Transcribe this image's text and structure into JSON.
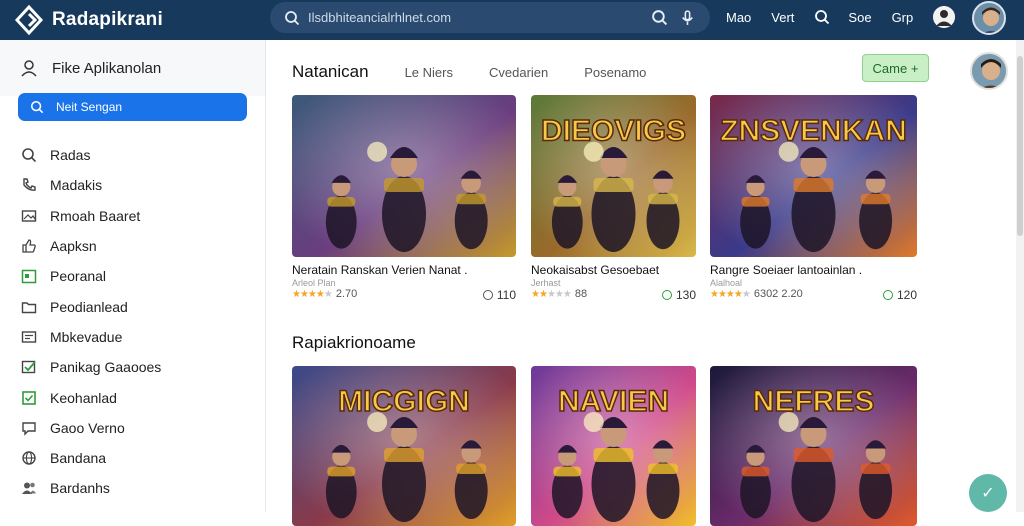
{
  "app": {
    "title": "Radapikrani"
  },
  "search": {
    "value": "Ilsdbhiteancialrhlnet.com"
  },
  "topnav": {
    "items": [
      "Mao",
      "Vert",
      "Soe",
      "Grp"
    ]
  },
  "sidebar": {
    "header": "Fike Aplikanolan",
    "search_button": "Neit Sengan",
    "items": [
      {
        "label": "Radas",
        "icon": "search-icon"
      },
      {
        "label": "Madakis",
        "icon": "phone-icon"
      },
      {
        "label": "Rmoah Baaret",
        "icon": "image-icon"
      },
      {
        "label": "Aapksn",
        "icon": "thumb-up-icon"
      },
      {
        "label": "Peoranal",
        "icon": "calendar-icon"
      },
      {
        "label": "Peodianlead",
        "icon": "folder-icon"
      },
      {
        "label": "Mbkevadue",
        "icon": "message-icon"
      },
      {
        "label": "Panikag Gaaooes",
        "icon": "check-square-icon"
      },
      {
        "label": "Keohanlad",
        "icon": "checkbox-icon"
      },
      {
        "label": "Gaoo Verno",
        "icon": "chat-icon"
      },
      {
        "label": "Bandana",
        "icon": "globe-icon"
      },
      {
        "label": "Bardanhs",
        "icon": "people-icon"
      }
    ]
  },
  "tabs": [
    "Natanican",
    "Le Niers",
    "Cvedarien",
    "Posenamo"
  ],
  "action_button": "Came +",
  "games_row1": [
    {
      "title": "Neratain Ranskan Verien Nanat .",
      "sub": "Arleol Plan",
      "stars": 4,
      "rating": "2.70",
      "count": "110",
      "count_color": "#555555",
      "palette": [
        "#3b5a7a",
        "#6a3d7e",
        "#c49a2a"
      ],
      "title_art": ""
    },
    {
      "title": "Neokaisabst Gesoebaet",
      "sub": "Jerhast",
      "stars": 2,
      "rating": "88",
      "count": "130",
      "count_color": "#2e9c3a",
      "palette": [
        "#5a7a3a",
        "#9a6a2a",
        "#d8b84a"
      ],
      "title_art": "DIEOVIGS"
    },
    {
      "title": "Rangre Soeiaer lantoainlan .",
      "sub": "Alalhoal",
      "stars": 4,
      "rating": "6302 2.20",
      "count": "120",
      "count_color": "#2e9c3a",
      "palette": [
        "#7a2a4a",
        "#3a3a8a",
        "#e07a2a"
      ],
      "title_art": "ZNSVENKAN"
    }
  ],
  "section2_title": "Rapiakrionoame",
  "games_row2": [
    {
      "title_art": "MICGIGN",
      "palette": [
        "#3a4a8a",
        "#8a3a4a",
        "#e0a02a"
      ]
    },
    {
      "title_art": "NAVIEN",
      "palette": [
        "#6a3a9a",
        "#d04a8a",
        "#f0c02a"
      ]
    },
    {
      "title_art": "NEFRES",
      "palette": [
        "#1a1a3a",
        "#6a2a6a",
        "#e05a2a"
      ]
    }
  ],
  "colors": {
    "topbar": "#17395c",
    "accent": "#1a73e8",
    "star": "#f5a623",
    "success": "#2e9c3a"
  }
}
